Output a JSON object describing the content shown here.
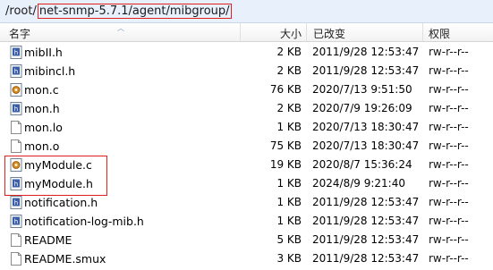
{
  "path": {
    "prefix": "/root/",
    "highlighted": "net-snmp-5.7.1/agent/mibgroup/"
  },
  "columns": {
    "name": "名字",
    "size": "大小",
    "modified": "已改变",
    "permissions": "权限"
  },
  "files": [
    {
      "name": "mibII.h",
      "size": "2 KB",
      "modified": "2011/9/28 12:53:47",
      "perm": "rw-r--r--",
      "icon": "header-file-icon"
    },
    {
      "name": "mibincl.h",
      "size": "2 KB",
      "modified": "2011/9/28 12:53:47",
      "perm": "rw-r--r--",
      "icon": "header-file-icon"
    },
    {
      "name": "mon.c",
      "size": "76 KB",
      "modified": "2020/7/13 9:51:50",
      "perm": "rw-r--r--",
      "icon": "c-source-icon"
    },
    {
      "name": "mon.h",
      "size": "2 KB",
      "modified": "2020/7/9 19:26:09",
      "perm": "rw-r--r--",
      "icon": "header-file-icon"
    },
    {
      "name": "mon.lo",
      "size": "1 KB",
      "modified": "2020/7/13 18:30:47",
      "perm": "rw-r--r--",
      "icon": "blank-file-icon"
    },
    {
      "name": "mon.o",
      "size": "75 KB",
      "modified": "2020/7/13 18:30:47",
      "perm": "rw-r--r--",
      "icon": "blank-file-icon"
    },
    {
      "name": "myModule.c",
      "size": "19 KB",
      "modified": "2020/8/7 15:36:24",
      "perm": "rw-r--r--",
      "icon": "c-source-icon"
    },
    {
      "name": "myModule.h",
      "size": "1 KB",
      "modified": "2024/8/9 9:21:40",
      "perm": "rw-r--r--",
      "icon": "header-file-icon"
    },
    {
      "name": "notification.h",
      "size": "1 KB",
      "modified": "2011/9/28 12:53:47",
      "perm": "rw-r--r--",
      "icon": "header-file-icon"
    },
    {
      "name": "notification-log-mib.h",
      "size": "1 KB",
      "modified": "2011/9/28 12:53:47",
      "perm": "rw-r--r--",
      "icon": "header-file-icon"
    },
    {
      "name": "README",
      "size": "5 KB",
      "modified": "2011/9/28 12:53:47",
      "perm": "rw-r--r--",
      "icon": "blank-file-icon"
    },
    {
      "name": "README.smux",
      "size": "3 KB",
      "modified": "2011/9/28 12:53:47",
      "perm": "rw-r--r--",
      "icon": "blank-file-icon"
    }
  ],
  "colors": {
    "highlight_border": "#e02020",
    "path_bar": "#e8f0fb"
  }
}
